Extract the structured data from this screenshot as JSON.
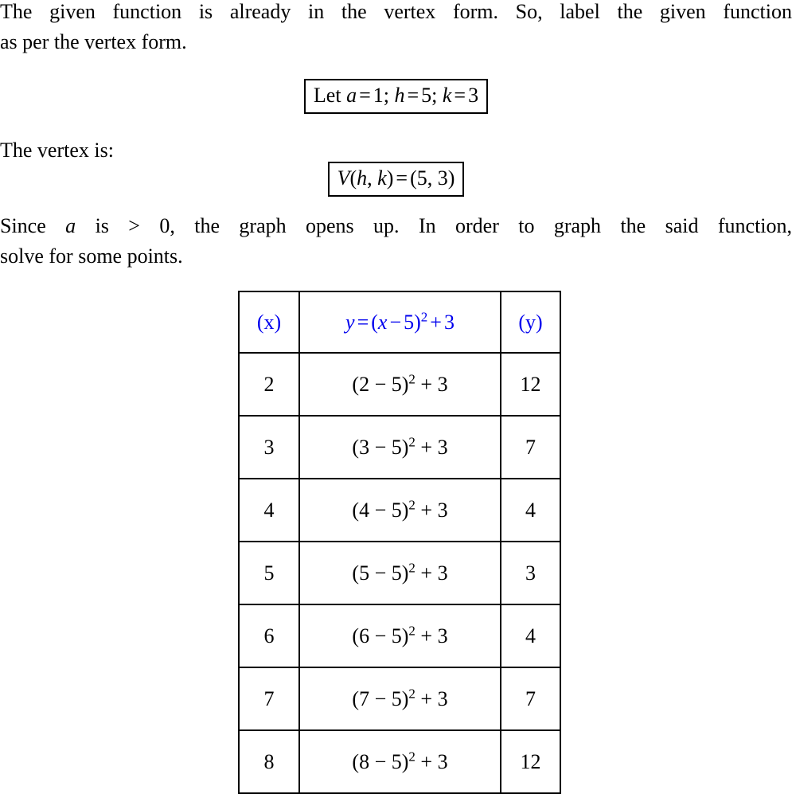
{
  "document": {
    "paragraph1": {
      "line1": "The given function is already in the vertex form.  So, label the given function",
      "line2": "as per the vertex form."
    },
    "boxed_equation_1": {
      "label": "Let",
      "a_var": "a",
      "a_eq": "=",
      "a_val": "1;",
      "h_var": "h",
      "h_eq": "=",
      "h_val": "5;",
      "k_var": "k",
      "k_eq": "=",
      "k_val": "3"
    },
    "paragraph2": {
      "line1": "The vertex is:"
    },
    "boxed_equation_2": {
      "v_symbol": "V",
      "open_paren": "(",
      "h_var": "h",
      "comma": ",",
      "k_var": "k",
      "close_paren": ")",
      "equals": "=",
      "point": "(5, 3)"
    },
    "paragraph3": {
      "line1_part1": "Since",
      "line1_var": "a",
      "line1_part2": "is > 0, the graph opens up.  In order to graph the said function,",
      "line2": "solve for some points."
    },
    "table": {
      "headers": {
        "x": "(x)",
        "formula_lhs": "y",
        "formula_eq": "=",
        "formula_open": "(",
        "formula_var": "x",
        "formula_minus": "−",
        "formula_h": "5",
        "formula_close": ")",
        "formula_exp": "2",
        "formula_plus": "+",
        "formula_k": "3",
        "y": "(y)"
      },
      "rows": [
        {
          "x": "2",
          "expr_open": "(2 − 5)",
          "expr_exp": "2",
          "expr_tail": "+ 3",
          "y": "12"
        },
        {
          "x": "3",
          "expr_open": "(3 − 5)",
          "expr_exp": "2",
          "expr_tail": "+ 3",
          "y": "7"
        },
        {
          "x": "4",
          "expr_open": "(4 − 5)",
          "expr_exp": "2",
          "expr_tail": "+ 3",
          "y": "4"
        },
        {
          "x": "5",
          "expr_open": "(5 − 5)",
          "expr_exp": "2",
          "expr_tail": "+ 3",
          "y": "3"
        },
        {
          "x": "6",
          "expr_open": "(6 − 5)",
          "expr_exp": "2",
          "expr_tail": "+ 3",
          "y": "4"
        },
        {
          "x": "7",
          "expr_open": "(7 − 5)",
          "expr_exp": "2",
          "expr_tail": "+ 3",
          "y": "7"
        },
        {
          "x": "8",
          "expr_open": "(8 − 5)",
          "expr_exp": "2",
          "expr_tail": "+ 3",
          "y": "12"
        }
      ]
    },
    "colors": {
      "header_blue": "#0000EE",
      "body_black": "#000000",
      "background": "#FFFFFF"
    }
  }
}
